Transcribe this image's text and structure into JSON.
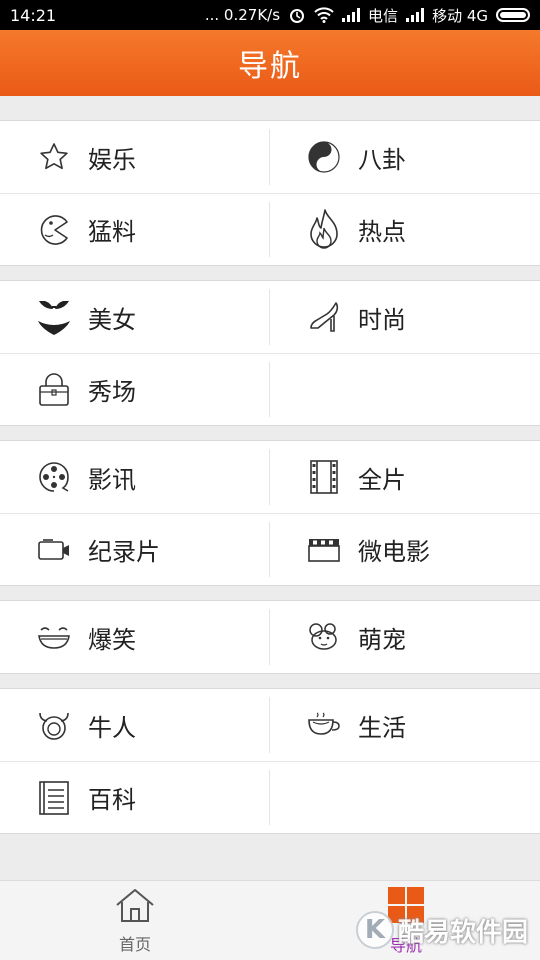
{
  "status_bar": {
    "time": "14:21",
    "speed": "... 0.27K/s",
    "carrier1": "电信",
    "carrier2": "移动 4G"
  },
  "header": {
    "title": "导航"
  },
  "sections": [
    {
      "rows": [
        [
          {
            "label": "娱乐",
            "icon": "star-icon"
          },
          {
            "label": "八卦",
            "icon": "yin-yang-icon"
          }
        ],
        [
          {
            "label": "猛料",
            "icon": "pacman-icon"
          },
          {
            "label": "热点",
            "icon": "flame-icon"
          }
        ]
      ]
    },
    {
      "rows": [
        [
          {
            "label": "美女",
            "icon": "bikini-icon"
          },
          {
            "label": "时尚",
            "icon": "high-heel-icon"
          }
        ],
        [
          {
            "label": "秀场",
            "icon": "handbag-icon"
          },
          null
        ]
      ]
    },
    {
      "rows": [
        [
          {
            "label": "影讯",
            "icon": "film-reel-icon"
          },
          {
            "label": "全片",
            "icon": "film-strip-icon"
          }
        ],
        [
          {
            "label": "纪录片",
            "icon": "video-camera-icon"
          },
          {
            "label": "微电影",
            "icon": "clapperboard-icon"
          }
        ]
      ]
    },
    {
      "rows": [
        [
          {
            "label": "爆笑",
            "icon": "laughing-face-icon"
          },
          {
            "label": "萌宠",
            "icon": "mouse-icon"
          }
        ]
      ]
    },
    {
      "rows": [
        [
          {
            "label": "牛人",
            "icon": "bull-icon"
          },
          {
            "label": "生活",
            "icon": "coffee-cup-icon"
          }
        ],
        [
          {
            "label": "百科",
            "icon": "book-icon"
          },
          null
        ]
      ]
    }
  ],
  "bottom_nav": {
    "home_label": "首页",
    "nav_label": "导航"
  },
  "watermark": {
    "text": "酷易软件园",
    "letter": "K"
  },
  "colors": {
    "accent": "#ea5a17",
    "active_tab": "#9b2fb0"
  }
}
